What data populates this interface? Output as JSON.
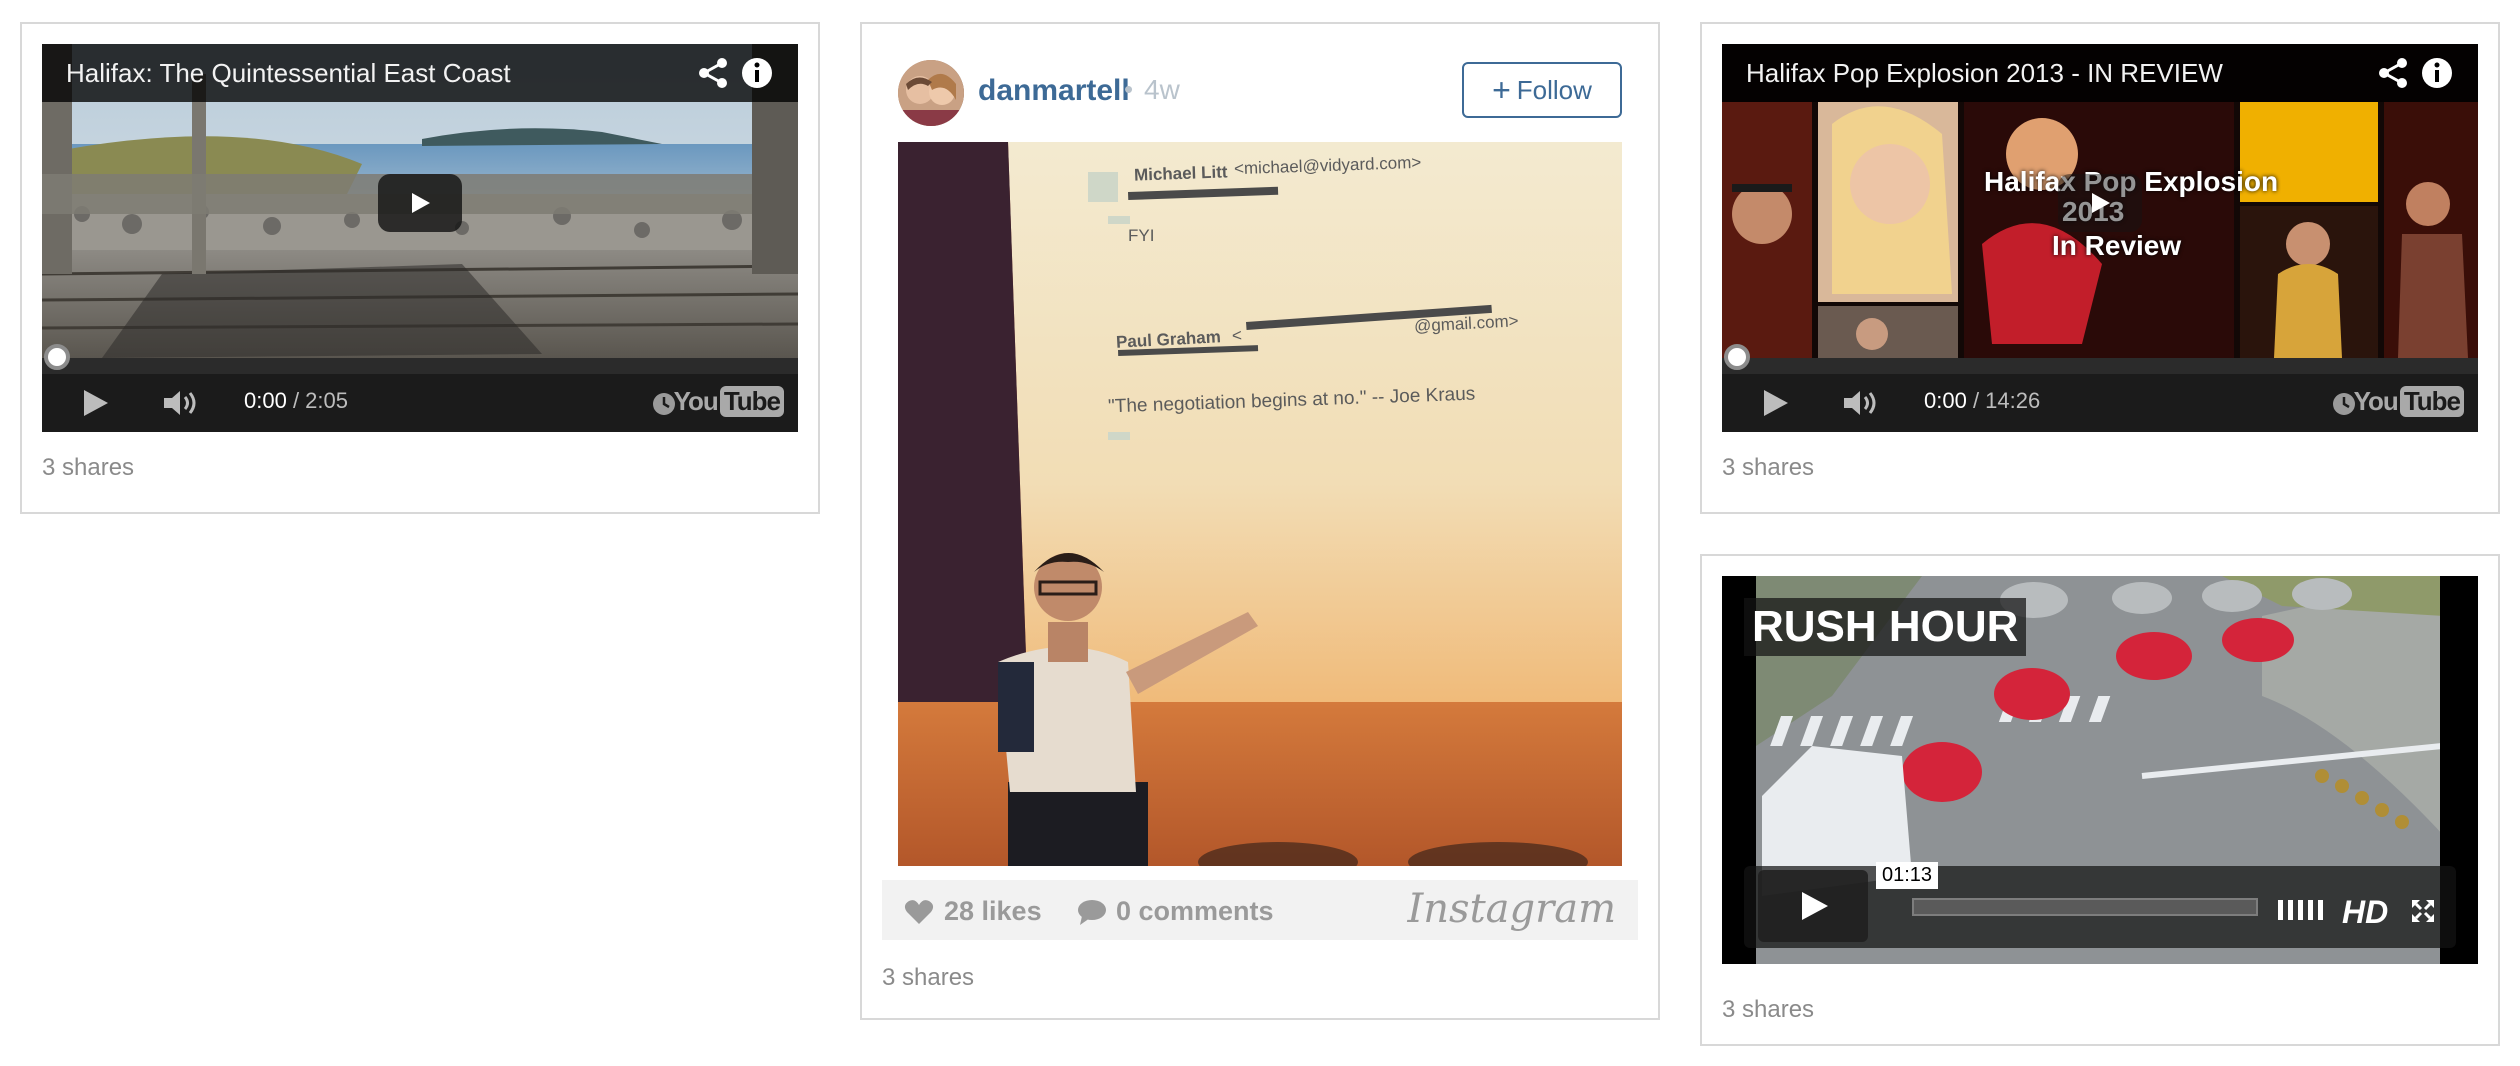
{
  "cards": {
    "video1": {
      "title": "Halifax: The Quintessential East Coast",
      "time_current": "0:00",
      "time_sep": " / ",
      "time_total": "2:05",
      "progress": 0.0,
      "shares": "3 shares",
      "logo_left": "You",
      "logo_right": "Tube"
    },
    "instagram": {
      "username": "danmartell",
      "separator": "•",
      "age": "4w",
      "follow_label": "Follow",
      "photo_text": {
        "sender1": "Michael Litt",
        "sender1_email": "<michael@vidyard.com>",
        "fyi": "FYI",
        "sender2": "Paul Graham",
        "sender2_email": "<",
        "sender2_email_end": "@gmail.com>",
        "quote": "\"The negotiation begins at no.\"  -- Joe Kraus"
      },
      "likes": "28 likes",
      "comments": "0 comments",
      "brand": "Instagram",
      "shares": "3 shares"
    },
    "video2": {
      "title": "Halifax Pop Explosion 2013 - IN REVIEW",
      "overlay_line1": "Halifax Pop Explosion",
      "overlay_line2": "2013",
      "overlay_line3": "In Review",
      "time_current": "0:00",
      "time_sep": " / ",
      "time_total": "14:26",
      "progress": 0.0,
      "shares": "3 shares",
      "logo_left": "You",
      "logo_right": "Tube"
    },
    "video3": {
      "title": "RUSH HOUR",
      "timecode": "01:13",
      "hd_label": "HD",
      "shares": "3 shares"
    }
  },
  "colors": {
    "card_border": "#d8d8d8",
    "instagram_blue": "#3d6a96",
    "muted_text": "#8a8a8a"
  }
}
